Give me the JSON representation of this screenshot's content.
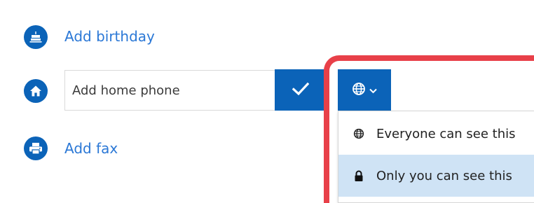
{
  "fields": {
    "birthday": {
      "label": "Add birthday",
      "icon": "cake-icon"
    },
    "home_phone": {
      "placeholder": "Add home phone",
      "value": "",
      "icon": "home-icon"
    },
    "fax": {
      "label": "Add fax",
      "icon": "printer-icon"
    }
  },
  "confirm_button": {
    "icon": "checkmark-icon"
  },
  "visibility_button": {
    "icon": "globe-icon",
    "caret": "chevron-down-icon"
  },
  "visibility_menu": {
    "items": [
      {
        "label": "Everyone can see this",
        "icon": "globe-icon",
        "selected": false
      },
      {
        "label": "Only you can see this",
        "icon": "lock-icon",
        "selected": true
      }
    ]
  },
  "colors": {
    "accent": "#0b63b8",
    "link": "#2b78d6",
    "highlight_outline": "#e84049",
    "selected_item": "#cfe3f5"
  }
}
